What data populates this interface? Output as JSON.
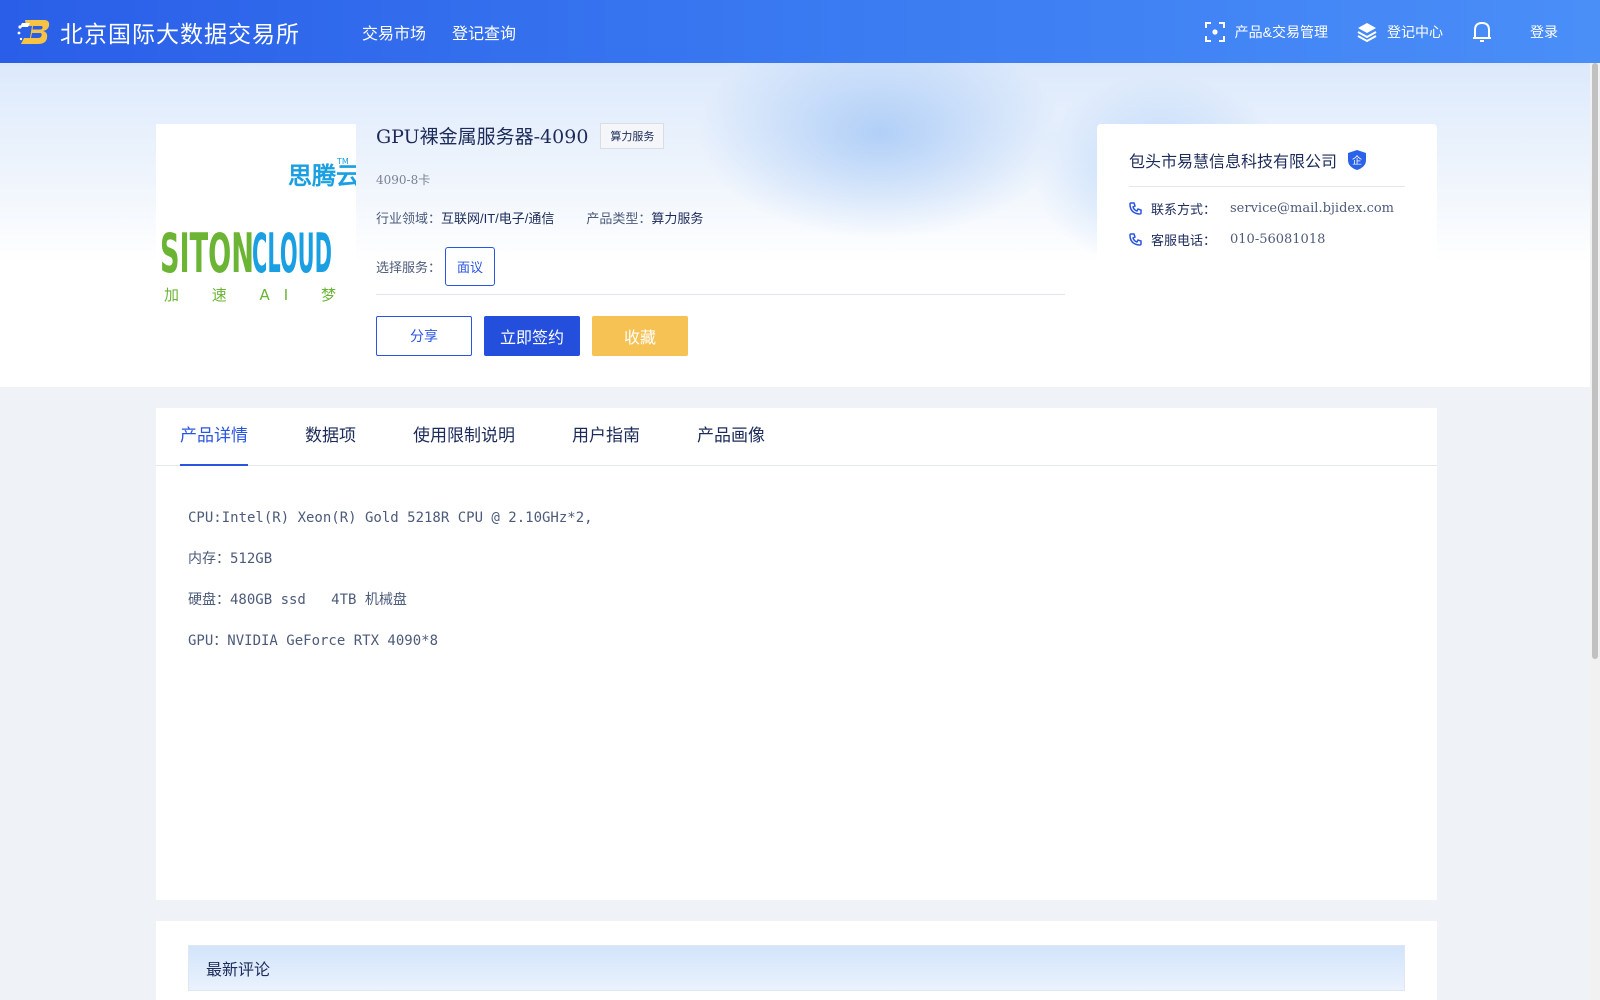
{
  "header": {
    "brand_name": "北京国际大数据交易所",
    "nav": [
      "交易市场",
      "登记查询"
    ],
    "right_nav": {
      "product_management": "产品&交易管理",
      "registration_center": "登记中心",
      "login": "登录"
    }
  },
  "product": {
    "logo_text": {
      "brand_cn": "思腾云",
      "brand_en": "SITONCLOUD",
      "slogan": "加 速 AI 梦 想"
    },
    "title": "GPU裸金属服务器-4090",
    "tag": "算力服务",
    "subtitle": "4090-8卡",
    "industry_label": "行业领域：",
    "industry_value": "互联网/IT/电子/通信",
    "type_label": "产品类型：",
    "type_value": "算力服务",
    "service_label": "选择服务：",
    "service_option": "面议",
    "actions": {
      "share": "分享",
      "sign": "立即签约",
      "favorite": "收藏"
    }
  },
  "company": {
    "name": "包头市易慧信息科技有限公司",
    "badge": "企",
    "contact_label": "联系方式：",
    "contact_value": "service@mail.bjidex.com",
    "phone_label": "客服电话：",
    "phone_value": "010-56081018"
  },
  "tabs": {
    "items": [
      "产品详情",
      "数据项",
      "使用限制说明",
      "用户指南",
      "产品画像"
    ],
    "active": "产品详情"
  },
  "details": [
    "CPU:Intel(R) Xeon(R) Gold 5218R CPU @ 2.10GHz*2,",
    "内存：512GB",
    "硬盘：480GB ssd   4TB 机械盘",
    "GPU：NVIDIA GeForce RTX 4090*8"
  ],
  "reviews": {
    "title": "最新评论"
  },
  "colors": {
    "primary": "#234fdc",
    "favorite": "#f5c253",
    "header_gradient_start": "#2a5ee8",
    "header_gradient_end": "#4a8ef8"
  }
}
